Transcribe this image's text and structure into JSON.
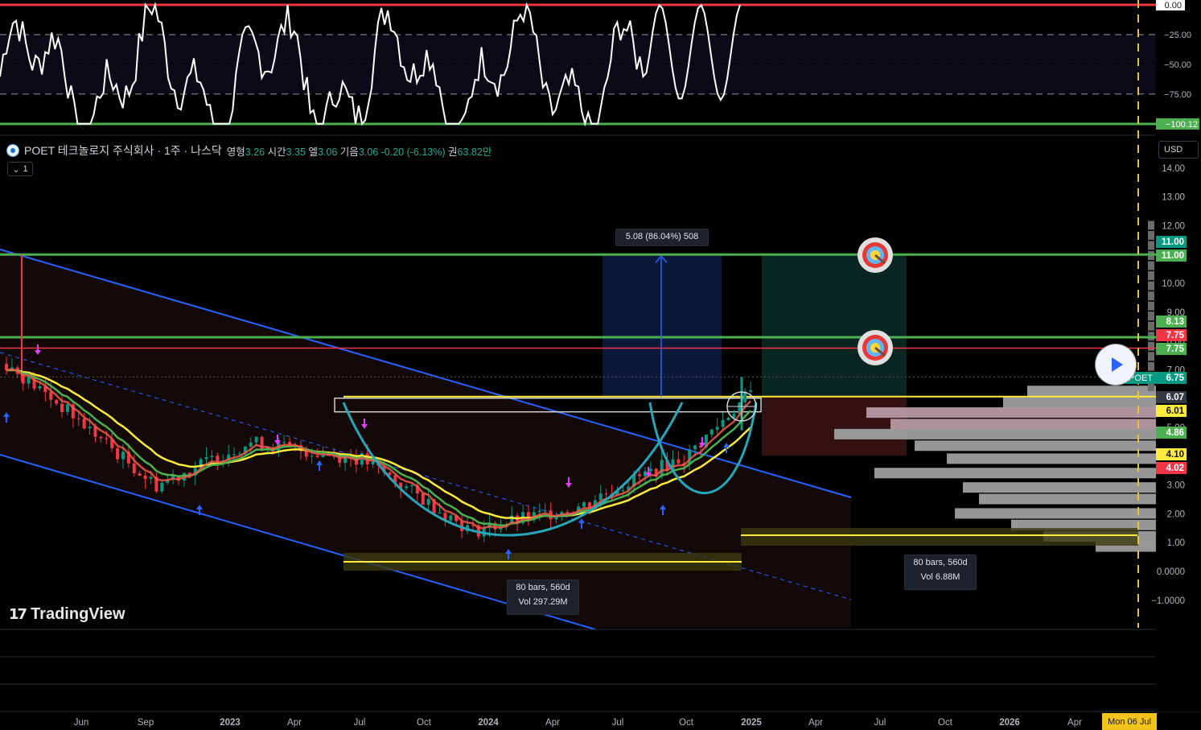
{
  "header": {
    "symbol": "POET 테크놀로지 주식회사 · 1주 · 나스닥",
    "o_label": "영형",
    "o_val": "3.26",
    "h_label": "시간",
    "h_val": "3.35",
    "l_label": "엘",
    "l_val": "3.06",
    "c_label": "기음",
    "c_val": "3.06",
    "change": "-0.20 (-6.13%)",
    "vol_label": "권",
    "vol_val": "63.82만",
    "interval_value": "1",
    "currency": "USD"
  },
  "chart_data": [
    {
      "type": "line",
      "panel": "oscillator",
      "y_ticks": [
        "0.00",
        "−25.00",
        "−50.00",
        "−75.00",
        "−100.12"
      ],
      "ylim": [
        -100.12,
        0
      ],
      "levels": [
        0,
        -25,
        -50,
        -75,
        -100.12
      ],
      "colors": {
        "line": "#ffffff",
        "upper": "#f23645",
        "lower": "#4caf50",
        "dashed": "#9598a1"
      }
    },
    {
      "type": "candlestick",
      "panel": "price",
      "x_ticks": [
        "Jun",
        "Sep",
        "2023",
        "Apr",
        "Jul",
        "Oct",
        "2024",
        "Apr",
        "Jul",
        "Oct",
        "2025",
        "Apr",
        "Jul",
        "Oct",
        "2026",
        "Apr"
      ],
      "y_ticks": [
        "14.00",
        "13.00",
        "12.00",
        "11.00",
        "10.00",
        "9.00",
        "8.00",
        "7.00",
        "6.00",
        "5.00",
        "4.00",
        "3.00",
        "2.00",
        "1.00",
        "0.0000",
        "−1.0000"
      ],
      "price_labels": [
        {
          "text": "11.00",
          "color": "#089981"
        },
        {
          "text": "11.00",
          "color": "#4caf50"
        },
        {
          "text": "8.13",
          "color": "#4caf50"
        },
        {
          "text": "7.75",
          "color": "#f23645"
        },
        {
          "text": "7.75",
          "color": "#4caf50"
        },
        {
          "text": "6.75",
          "color": "#089981"
        },
        {
          "text": "6.07",
          "color": "#363a45"
        },
        {
          "text": "6.01",
          "color": "#ffeb3b"
        },
        {
          "text": "4.86",
          "color": "#4caf50"
        },
        {
          "text": "4.10",
          "color": "#ffeb3b"
        },
        {
          "text": "4.02",
          "color": "#f23645"
        }
      ],
      "symbol_tag": "POET",
      "horizontal_levels": [
        11.0,
        7.75,
        6.07,
        6.01
      ],
      "measure_label": "5.08 (86.04%) 508",
      "range_label_1": [
        "80 bars, 560d",
        "Vol 297.29M"
      ],
      "range_label_2": [
        "80 bars, 560d",
        "Vol 6.88M"
      ],
      "date_chip": "Mon 06 Jul",
      "colors": {
        "up": "#089981",
        "down": "#f23645",
        "ema_fast": "#f0584a",
        "ema_mid": "#4caf50",
        "ema_slow": "#ffeb3b",
        "channel": "#2962ff",
        "cup": "#26a6b8"
      }
    }
  ],
  "branding": {
    "name": "TradingView"
  }
}
